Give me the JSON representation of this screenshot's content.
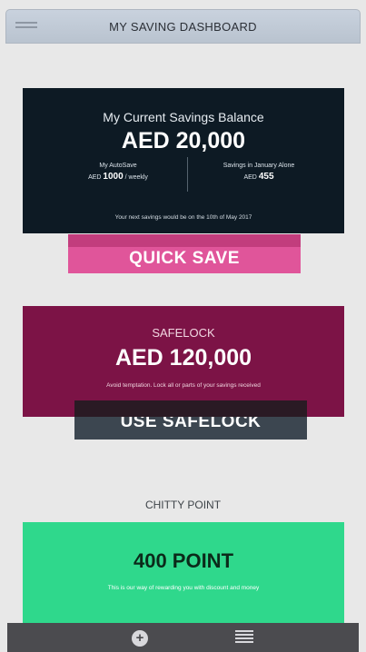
{
  "header": {
    "title": "MY SAVING DASHBOARD",
    "menu_icon": "hamburger-menu-icon"
  },
  "savings": {
    "title": "My Current Savings Balance",
    "amount": "AED 20,000",
    "autosave": {
      "label": "My AutoSave",
      "currency": "AED",
      "amount": "1000",
      "period": "/ weekly"
    },
    "january": {
      "label": "Savings in January Alone",
      "currency": "AED",
      "amount": "455"
    },
    "note": "Your next savings would be on the 10th of May 2017",
    "button_label": "QUICK SAVE"
  },
  "safelock": {
    "title": "SAFELOCK",
    "amount": "AED 120,000",
    "note": "Avoid temptation. Lock all or parts of your savings received",
    "button_label": "USE SAFELOCK"
  },
  "chitty": {
    "heading": "CHITTY POINT",
    "points": "400 POINT",
    "note": "This is our way of rewarding you with discount and money"
  },
  "bottom_bar": {
    "plus_icon_glyph": "+",
    "icons": [
      "plus-circle-icon",
      "list-icon"
    ]
  },
  "colors": {
    "header": "#c4cdd9",
    "savings_card": "#0d1a24",
    "quick_save": "#e0559a",
    "safelock_card": "#7c1346",
    "use_safelock": "#3c4650",
    "chitty_card": "#2fd88c",
    "bottom_bar": "#4b4b4f"
  }
}
